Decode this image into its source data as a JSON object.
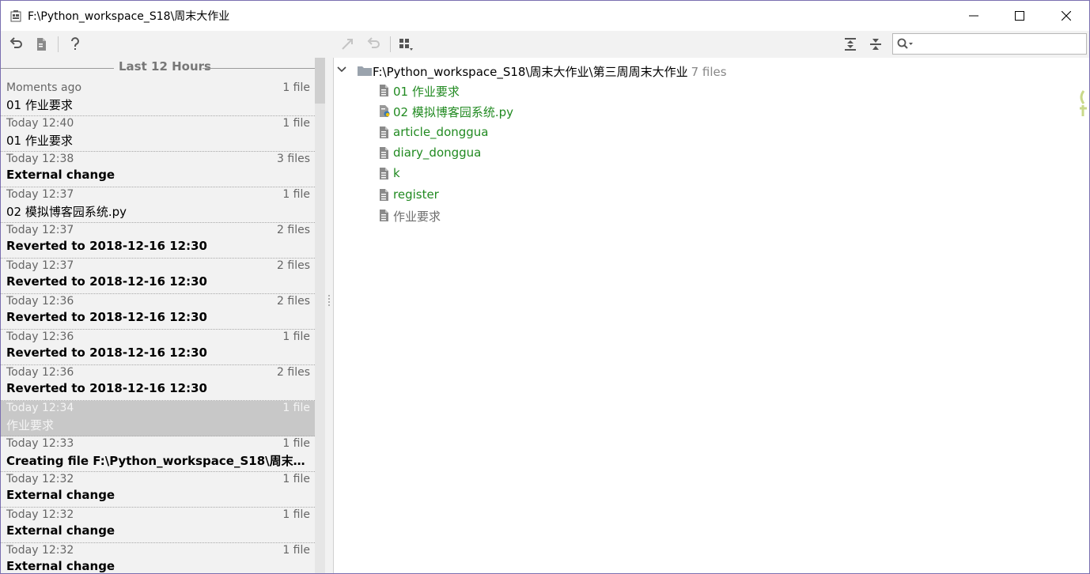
{
  "window": {
    "title": "F:\\Python_workspace_S18\\周末大作业"
  },
  "toolbar": {
    "left_icons": [
      "revert-icon",
      "document-icon",
      "help-icon"
    ],
    "right_icons": [
      "merge-icon",
      "undo-icon",
      "group-by-icon",
      "expand-all-icon",
      "collapse-all-icon"
    ],
    "search_value": "",
    "search_icon": "search-icon"
  },
  "history": {
    "group_label": "Last 12 Hours",
    "items": [
      {
        "time": "Moments ago",
        "count": "1 file",
        "label": "01 作业要求",
        "bold": false,
        "selected": false
      },
      {
        "time": "Today 12:40",
        "count": "1 file",
        "label": "01 作业要求",
        "bold": false,
        "selected": false
      },
      {
        "time": "Today 12:38",
        "count": "3 files",
        "label": "External change",
        "bold": true,
        "selected": false
      },
      {
        "time": "Today 12:37",
        "count": "1 file",
        "label": "02 模拟博客园系统.py",
        "bold": false,
        "selected": false
      },
      {
        "time": "Today 12:37",
        "count": "2 files",
        "label": "Reverted to 2018-12-16 12:30",
        "bold": true,
        "selected": false
      },
      {
        "time": "Today 12:37",
        "count": "2 files",
        "label": "Reverted to 2018-12-16 12:30",
        "bold": true,
        "selected": false
      },
      {
        "time": "Today 12:36",
        "count": "2 files",
        "label": "Reverted to 2018-12-16 12:30",
        "bold": true,
        "selected": false
      },
      {
        "time": "Today 12:36",
        "count": "1 file",
        "label": "Reverted to 2018-12-16 12:30",
        "bold": true,
        "selected": false
      },
      {
        "time": "Today 12:36",
        "count": "2 files",
        "label": "Reverted to 2018-12-16 12:30",
        "bold": true,
        "selected": false
      },
      {
        "time": "Today 12:34",
        "count": "1 file",
        "label": "作业要求",
        "bold": false,
        "selected": true
      },
      {
        "time": "Today 12:33",
        "count": "1 file",
        "label": "Creating file F:\\Python_workspace_S18\\周末大作业...",
        "bold": true,
        "selected": false
      },
      {
        "time": "Today 12:32",
        "count": "1 file",
        "label": "External change",
        "bold": true,
        "selected": false
      },
      {
        "time": "Today 12:32",
        "count": "1 file",
        "label": "External change",
        "bold": true,
        "selected": false
      },
      {
        "time": "Today 12:32",
        "count": "1 file",
        "label": "External change",
        "bold": true,
        "selected": false
      }
    ]
  },
  "tree": {
    "root_path": "F:\\Python_workspace_S18\\周末大作业\\第三周周末大作业",
    "root_count": "7 files",
    "files": [
      {
        "name": "01 作业要求",
        "color": "#218a21",
        "icon": "text-file-icon"
      },
      {
        "name": "02 模拟博客园系统.py",
        "color": "#218a21",
        "icon": "python-file-icon"
      },
      {
        "name": "article_donggua",
        "color": "#218a21",
        "icon": "text-file-icon"
      },
      {
        "name": "diary_donggua",
        "color": "#218a21",
        "icon": "text-file-icon"
      },
      {
        "name": "k",
        "color": "#218a21",
        "icon": "text-file-icon"
      },
      {
        "name": "register",
        "color": "#218a21",
        "icon": "text-file-icon"
      },
      {
        "name": "作业要求",
        "color": "#6e6e6e",
        "icon": "text-file-icon"
      }
    ]
  },
  "colors": {
    "added": "#218a21",
    "deleted": "#6e6e6e",
    "selection": "#c8c8c8"
  }
}
